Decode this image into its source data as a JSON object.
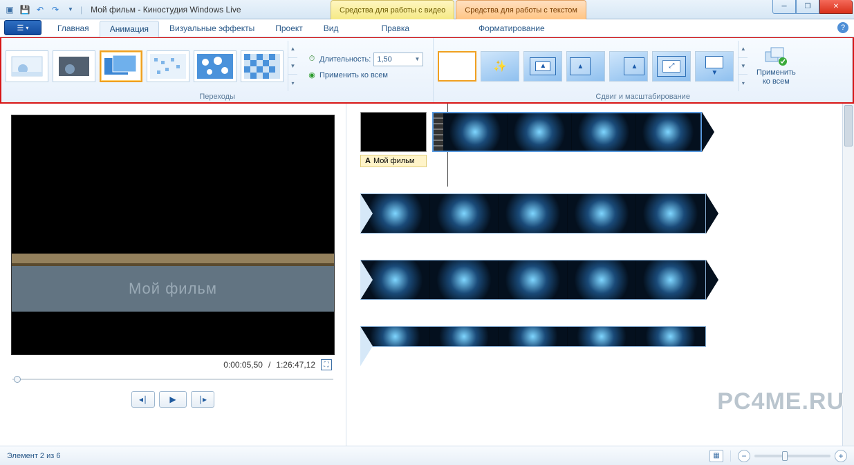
{
  "title": "Мой фильм - Киностудия Windows Live",
  "context_tabs": {
    "video": "Средства для работы с видео",
    "text": "Средства для работы с текстом"
  },
  "ribbon_tabs": {
    "home": "Главная",
    "animation": "Анимация",
    "effects": "Визуальные эффекты",
    "project": "Проект",
    "view": "Вид",
    "edit": "Правка",
    "format": "Форматирование"
  },
  "groups": {
    "transitions": "Переходы",
    "panzoom": "Сдвиг и масштабирование"
  },
  "duration_label": "Длительность:",
  "duration_value": "1,50",
  "apply_all": "Применить ко всем",
  "apply_all_btn": "Применить\nко всем",
  "preview_title_overlay": "Мой фильм",
  "time": {
    "current": "0:00:05,50",
    "total": "1:26:47,12"
  },
  "title_caption": "Мой фильм",
  "status_text": "Элемент 2 из 6",
  "watermark": "PC4ME.RU"
}
